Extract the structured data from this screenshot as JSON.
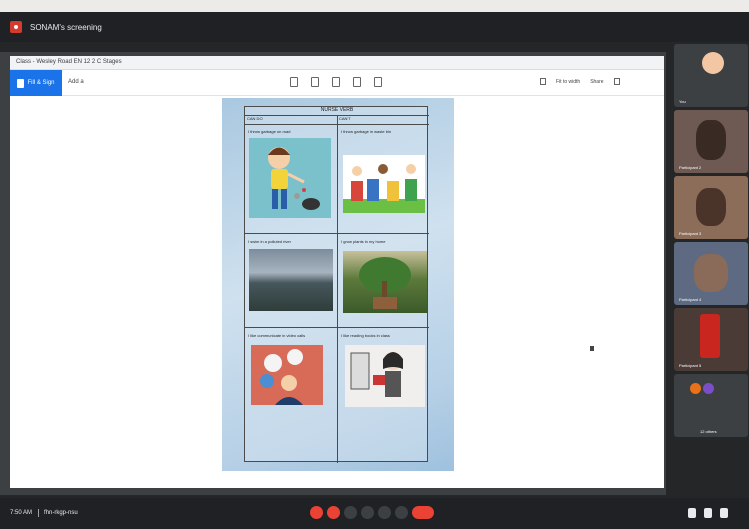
{
  "window": {
    "title": "SONAM's screening"
  },
  "document": {
    "file_name": "Class - Wesley Road EN 12 2 C Stages",
    "heading": "NURSE VERB",
    "col_left": "CAN DO",
    "col_right": "CAN'T",
    "captions": [
      "I throw garbage on road",
      "I throw garbage in waste bin",
      "I swim in a polluted river",
      "I grow plants in my home",
      "I like communicate in video calls",
      "I like reading books in class"
    ]
  },
  "toolbar": {
    "primary_label": "Fill & Sign",
    "add_label": "Add a",
    "view_label": "Fit to width",
    "share_label": "Share"
  },
  "participants": [
    {
      "label": "You"
    },
    {
      "label": "Participant 2"
    },
    {
      "label": "Participant 3"
    },
    {
      "label": "Participant 4"
    },
    {
      "label": "Participant 5"
    },
    {
      "label": "12 others"
    }
  ],
  "footer": {
    "time": "7:50 AM",
    "meeting_code": "fhn-rkgp-nsu"
  },
  "icons": [
    "record-icon",
    "expand-icon",
    "mic-icon",
    "camera-icon",
    "caption-icon",
    "raise-hand-icon",
    "present-icon",
    "more-icon",
    "end-call-icon",
    "info-icon",
    "people-icon",
    "chat-icon"
  ]
}
